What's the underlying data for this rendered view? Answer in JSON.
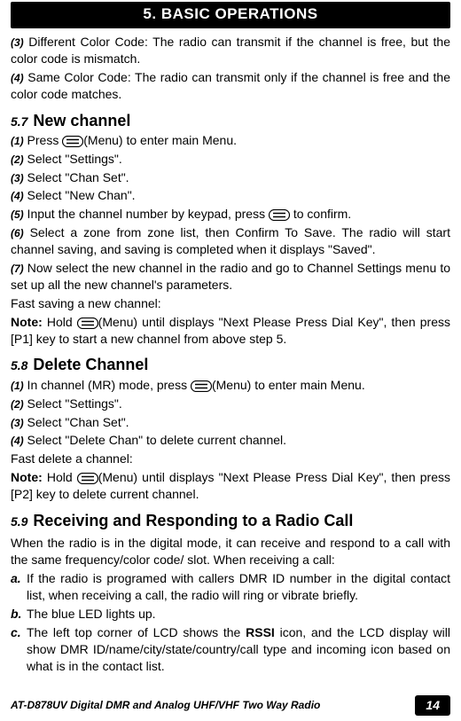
{
  "chapter_title": "5. BASIC OPERATIONS",
  "intro": {
    "s3_num": "(3)",
    "s3_text": " Different Color Code: The radio can transmit if the channel is free, but the color code is mismatch.",
    "s4_num": "(4)",
    "s4_text": " Same Color Code: The radio can transmit only if the channel is free and the color code matches."
  },
  "sec57": {
    "num": "5.7",
    "title": "New channel",
    "s1_num": "(1)",
    "s1_text_a": " Press ",
    "s1_text_b": "(Menu) to enter main Menu.",
    "s2_num": "(2)",
    "s2_text": " Select \"Settings\".",
    "s3_num": "(3)",
    "s3_text": " Select \"Chan Set\".",
    "s4_num": "(4)",
    "s4_text": " Select \"New Chan\".",
    "s5_num": "(5)",
    "s5_text_a": " Input the channel number by keypad, press ",
    "s5_text_b": " to confirm.",
    "s6_num": "(6)",
    "s6_text": " Select a zone from zone list, then Confirm To Save. The radio will start channel saving, and saving is completed when it displays \"Saved\".",
    "s7_num": "(7)",
    "s7_text": " Now select the new channel in the radio and go to Channel Settings menu to set up all the new channel's parameters.",
    "fast_label": "Fast saving a new channel:",
    "note_label": "Note:",
    "note_text_a": " Hold ",
    "note_text_b": "(Menu) until displays \"Next Please Press Dial Key\", then press [P1] key to start a new channel from above step 5."
  },
  "sec58": {
    "num": "5.8",
    "title": "Delete Channel",
    "s1_num": "(1)",
    "s1_text_a": " In channel (MR) mode, press ",
    "s1_text_b": "(Menu) to enter main Menu.",
    "s2_num": "(2)",
    "s2_text": " Select \"Settings\".",
    "s3_num": "(3)",
    "s3_text": " Select \"Chan Set\".",
    "s4_num": "(4)",
    "s4_text": " Select \"Delete Chan\" to delete current channel.",
    "fast_label": "Fast delete a channel:",
    "note_label": "Note:",
    "note_text_a": " Hold ",
    "note_text_b": "(Menu) until displays \"Next Please Press Dial Key\", then press [P2] key to delete current channel."
  },
  "sec59": {
    "num": "5.9",
    "title": "Receiving and Responding to a Radio Call",
    "intro": "When the radio is in the digital mode, it can receive and respond to a call with the same frequency/color code/ slot. When receiving a call:",
    "a_num": "a.",
    "a_text": "If the radio is programed with callers DMR ID number in the digital contact list, when receiving a call, the radio will ring or vibrate briefly.",
    "b_num": "b.",
    "b_text": "The blue LED lights up.",
    "c_num": "c.",
    "c_text_a": "The left top corner of LCD shows the ",
    "c_bold": "RSSI",
    "c_text_b": " icon, and the LCD display will show DMR ID/name/city/state/country/call type and incoming icon based on what is in the contact list."
  },
  "footer_text": "AT-D878UV Digital DMR and Analog UHF/VHF Two Way Radio",
  "page_number": "14"
}
